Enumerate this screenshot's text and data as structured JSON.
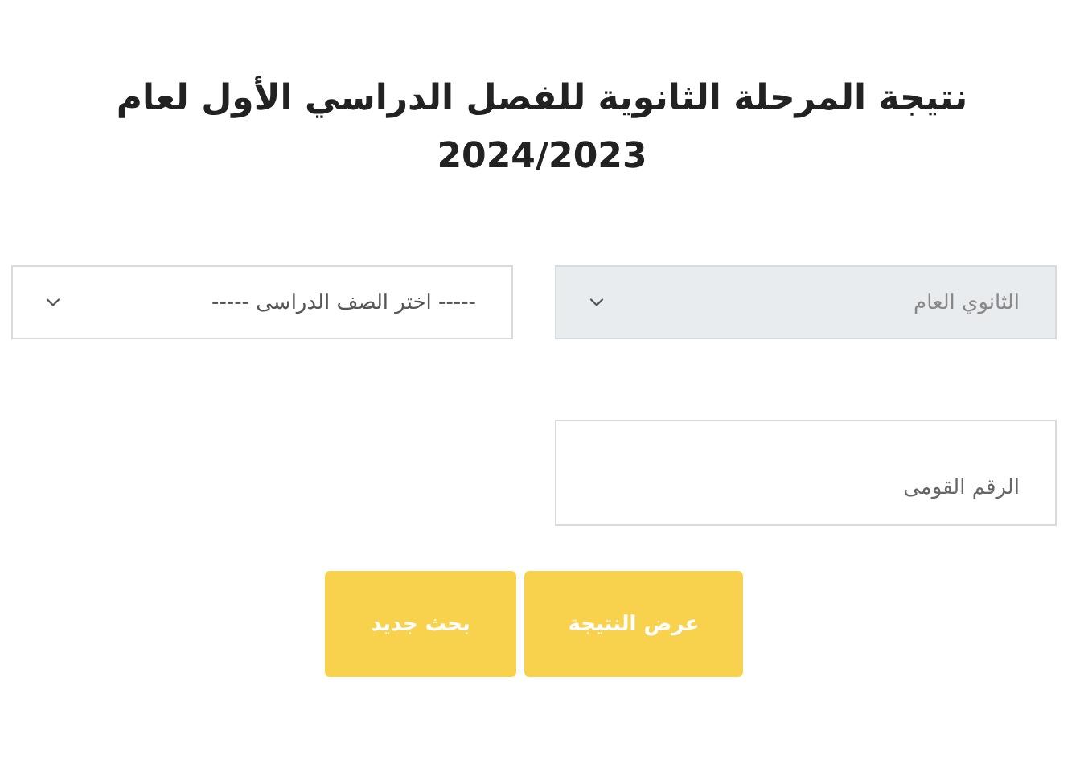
{
  "title": "نتيجة المرحلة الثانوية للفصل الدراسي الأول لعام 2024/2023",
  "selects": [
    {
      "value": "الثانوي العام",
      "disabled": true
    },
    {
      "value": "----- اختر الصف الدراسى -----",
      "disabled": false
    }
  ],
  "national_id_field": {
    "placeholder": "الرقم القومى"
  },
  "buttons": [
    "عرض النتيجة",
    "بحث جديد"
  ]
}
